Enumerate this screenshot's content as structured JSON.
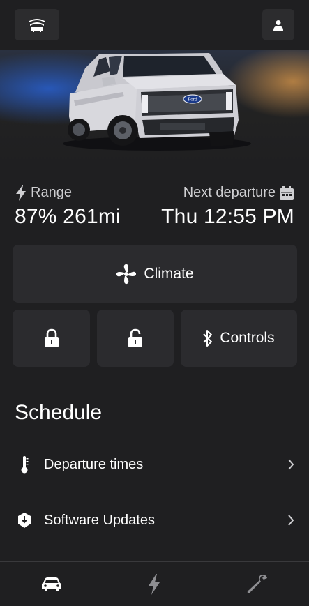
{
  "header": {
    "garage_icon": "garage-icon",
    "profile_icon": "person-icon"
  },
  "vehicle": {
    "brand_badge": "Ford",
    "image": "ford-f150-lightning-truck"
  },
  "stats": {
    "range_label": "Range",
    "range_value": "87% 261mi",
    "departure_label": "Next departure",
    "departure_value": "Thu 12:55 PM"
  },
  "controls": {
    "climate_label": "Climate",
    "controls_label": "Controls"
  },
  "schedule": {
    "title": "Schedule",
    "items": [
      {
        "label": "Departure times",
        "icon": "thermometer-icon"
      },
      {
        "label": "Software Updates",
        "icon": "download-shield-icon"
      }
    ]
  },
  "nav": {
    "items": [
      "vehicle-icon",
      "charging-icon",
      "service-icon"
    ]
  },
  "colors": {
    "background": "#1f1f21",
    "card": "#2b2b2e",
    "text": "#ffffff",
    "muted": "#cfcfd2",
    "inactive_icon": "#8e8e92"
  }
}
